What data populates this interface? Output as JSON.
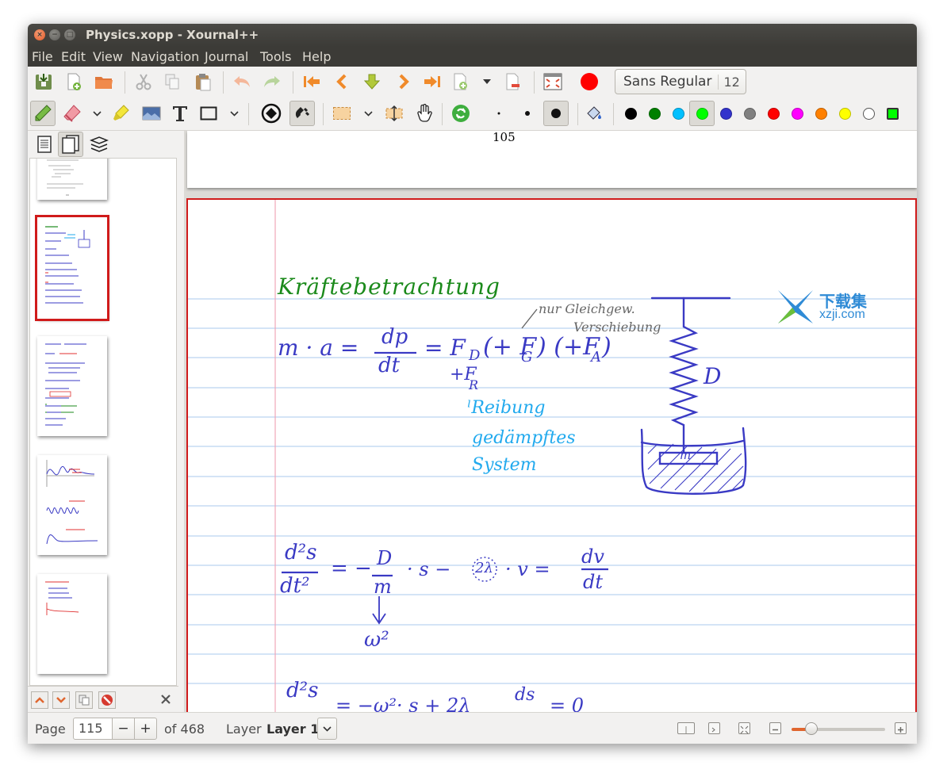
{
  "window": {
    "title": "Physics.xopp - Xournal++"
  },
  "menu": [
    "File",
    "Edit",
    "View",
    "Navigation",
    "Journal",
    "Tools",
    "Help"
  ],
  "toolbar": {
    "font_name": "Sans Regular",
    "font_size": "12",
    "record_color": "#ff0000",
    "palette": [
      "#000000",
      "#008000",
      "#00c0ff",
      "#00ff00",
      "#3333cc",
      "#808080",
      "#ff0000",
      "#ff00ff",
      "#ff8000",
      "#ffff00",
      "#ffffff",
      "#00ff00"
    ],
    "selected_palette_index": 3
  },
  "sidebar": {
    "tabs": [
      "page-preview",
      "document-pages",
      "layers"
    ],
    "selected_thumbnail": 1
  },
  "canvas": {
    "prev_page_number": "105",
    "ink": {
      "heading": "Kräftebetrachtung",
      "eq1_lhs": "m · a =",
      "eq1_frac_num": "dp",
      "eq1_frac_den": "dt",
      "eq1_rhs": "= F",
      "eq1_sub_d": "D",
      "eq1_fg": "(+ F",
      "eq1_sub_g": "G",
      "eq1_fa": ") (+F",
      "eq1_sub_a": "A",
      "eq1_close": ")",
      "note_line1": "nur Gleichgew.",
      "note_line2": "Verschiebung",
      "fr": "+F",
      "fr_sub": "R",
      "reib1": "Reibung",
      "reib2": "gedämpftes",
      "reib3": "System",
      "spring_label": "D",
      "mass_label": "m",
      "eq2_num": "d²s",
      "eq2_den": "dt²",
      "eq2_mid": "= −",
      "eq2_d": "D",
      "eq2_m": "m",
      "eq2_rest": "· s  −",
      "eq2_2l": "2λ",
      "eq2_v": "· v  =",
      "eq2_dv": "dv",
      "eq2_dt": "dt",
      "omega": "ω²",
      "eq3_num": "d²s",
      "eq3_rest": "= −ω²· s  + 2λ",
      "eq3_ds": "ds",
      "eq3_end": "= 0"
    },
    "watermark": {
      "cn": "下载集",
      "url": "xzji.com"
    }
  },
  "status": {
    "page_label": "Page",
    "page_value": "115",
    "minus": "−",
    "plus": "+",
    "of_label": "of 468",
    "layer_label": "Layer",
    "layer_value": "Layer 1"
  },
  "colors": {
    "ink_blue": "#3a3ac4",
    "ink_green": "#1b8a1b",
    "ink_cyan": "#22aaee",
    "ink_gray": "#666666"
  }
}
